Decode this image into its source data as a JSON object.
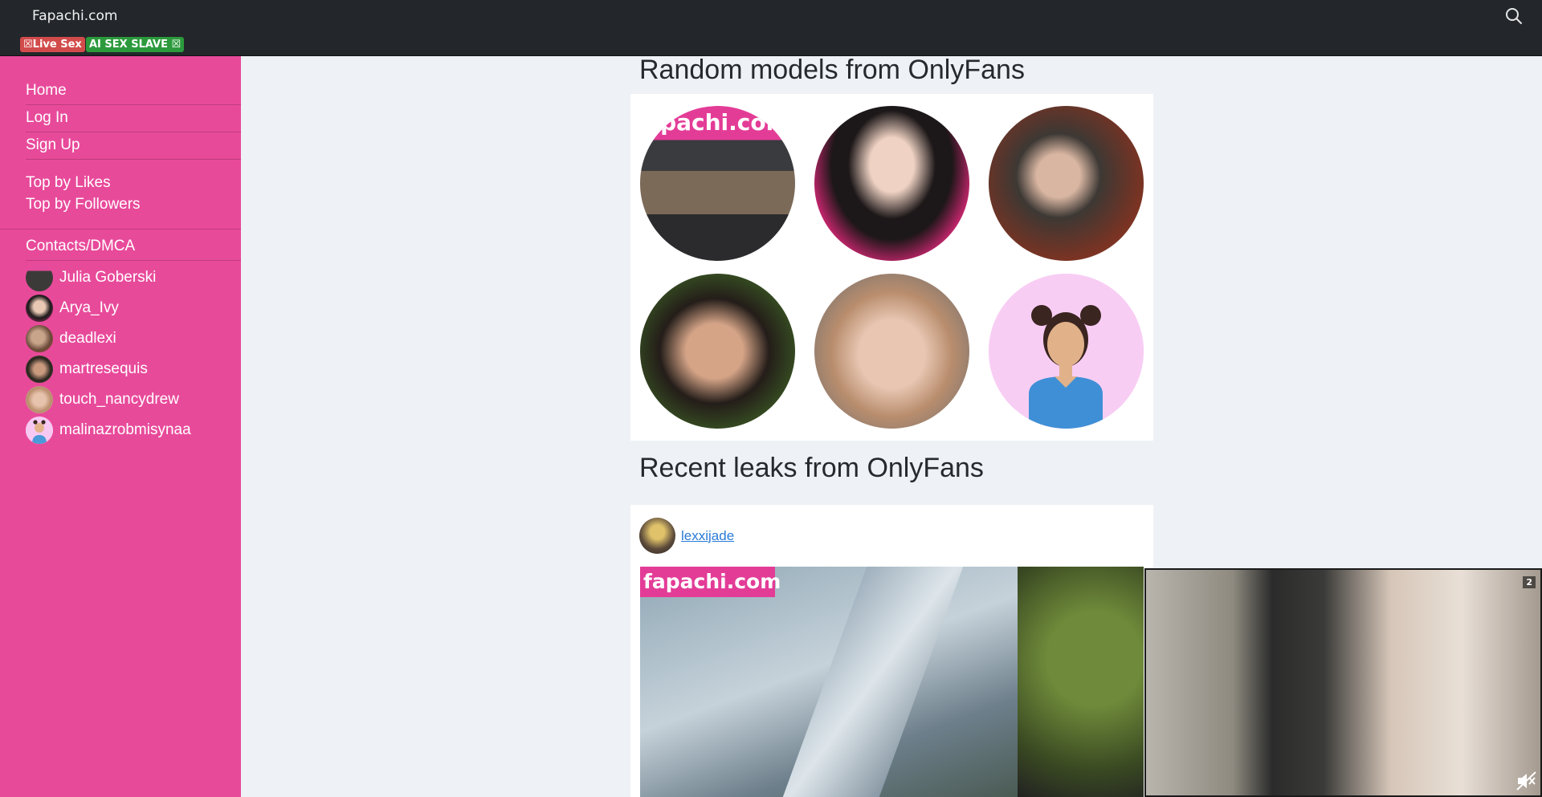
{
  "site": {
    "brand": "Fapachi.com"
  },
  "badges": {
    "live": "☒Live Sex",
    "ai": "AI SEX SLAVE ☒"
  },
  "sidebar": {
    "nav": [
      "Home",
      "Log In",
      "Sign Up"
    ],
    "top": [
      "Top by Likes",
      "Top by Followers"
    ],
    "contacts": "Contacts/DMCA",
    "models": [
      "Julia Goberski",
      "Arya_Ivy",
      "deadlexi",
      "martresequis",
      "touch_nancydrew",
      "malinazrobmisynaa"
    ]
  },
  "main": {
    "random_heading": "Random models from OnlyFans",
    "recent_heading": "Recent leaks from OnlyFans",
    "watermark": "fapachi.com",
    "post": {
      "username": "lexxijade"
    }
  },
  "video": {
    "counter": "2"
  },
  "colors": {
    "sidebar": "#e84a9a",
    "topbar": "#23272b",
    "live_badge": "#d24b4b",
    "ai_badge": "#2c9a3c",
    "link": "#2a7bd6"
  }
}
